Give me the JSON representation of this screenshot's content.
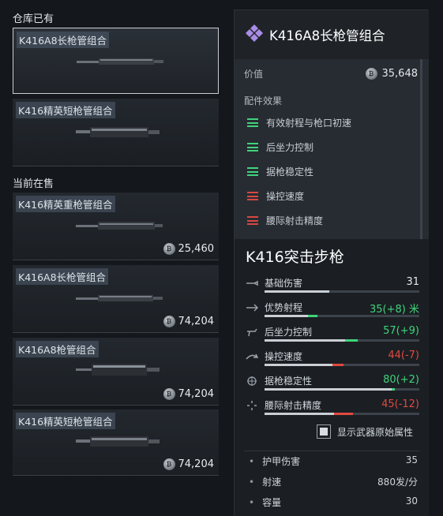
{
  "left": {
    "warehouse_title": "仓库已有",
    "warehouse_items": [
      {
        "name": "K416A8长枪管组合",
        "selected": true
      },
      {
        "name": "K416精英短枪管组合",
        "selected": false
      }
    ],
    "sale_title": "当前在售",
    "sale_items": [
      {
        "name": "K416精英重枪管组合",
        "price": "25,460"
      },
      {
        "name": "K416A8长枪管组合",
        "price": "74,204"
      },
      {
        "name": "K416A8枪管组合",
        "price": "74,204"
      },
      {
        "name": "K416精英短枪管组合",
        "price": "74,204"
      }
    ]
  },
  "detail": {
    "title": "K416A8长枪管组合",
    "value_label": "价值",
    "value": "35,648",
    "effects_title": "配件效果",
    "effects": [
      {
        "label": "有效射程与枪口初速",
        "effect": "positive",
        "color": "#3fd47a"
      },
      {
        "label": "后坐力控制",
        "effect": "positive",
        "color": "#3fd47a"
      },
      {
        "label": "据枪稳定性",
        "effect": "positive",
        "color": "#3fd47a"
      },
      {
        "label": "操控速度",
        "effect": "negative",
        "color": "#d9473f"
      },
      {
        "label": "腰际射击精度",
        "effect": "negative",
        "color": "#d9473f"
      }
    ]
  },
  "weapon": {
    "name": "K416突击步枪",
    "stats": [
      {
        "label": "基础伤害",
        "value": "31",
        "tone": "neutral",
        "icon": "bullet-icon",
        "base_pct": 0.42,
        "delta_pct": 0
      },
      {
        "label": "优势射程",
        "value": "35(+8) 米",
        "tone": "positive",
        "icon": "range-icon",
        "base_pct": 0.28,
        "delta_pct": 0.06
      },
      {
        "label": "后坐力控制",
        "value": "57(+9)",
        "tone": "positive",
        "icon": "recoil-icon",
        "base_pct": 0.52,
        "delta_pct": 0.08
      },
      {
        "label": "操控速度",
        "value": "44(-7)",
        "tone": "negative",
        "icon": "handling-icon",
        "base_pct": 0.44,
        "delta_pct": -0.07
      },
      {
        "label": "据枪稳定性",
        "value": "80(+2)",
        "tone": "positive",
        "icon": "crosshair-icon",
        "base_pct": 0.82,
        "delta_pct": 0.02
      },
      {
        "label": "腰际射击精度",
        "value": "45(-12)",
        "tone": "negative",
        "icon": "hipfire-icon",
        "base_pct": 0.45,
        "delta_pct": -0.12
      }
    ],
    "toggle_label": "显示武器原始属性",
    "attributes": [
      {
        "label": "护甲伤害",
        "value": "35"
      },
      {
        "label": "射速",
        "value": "880发/分"
      },
      {
        "label": "容量",
        "value": "30"
      }
    ]
  },
  "colors": {
    "positive": "#3fd47a",
    "negative": "#e0493f",
    "neutral": "#e4e8ec",
    "accent": "#a98ce6"
  }
}
